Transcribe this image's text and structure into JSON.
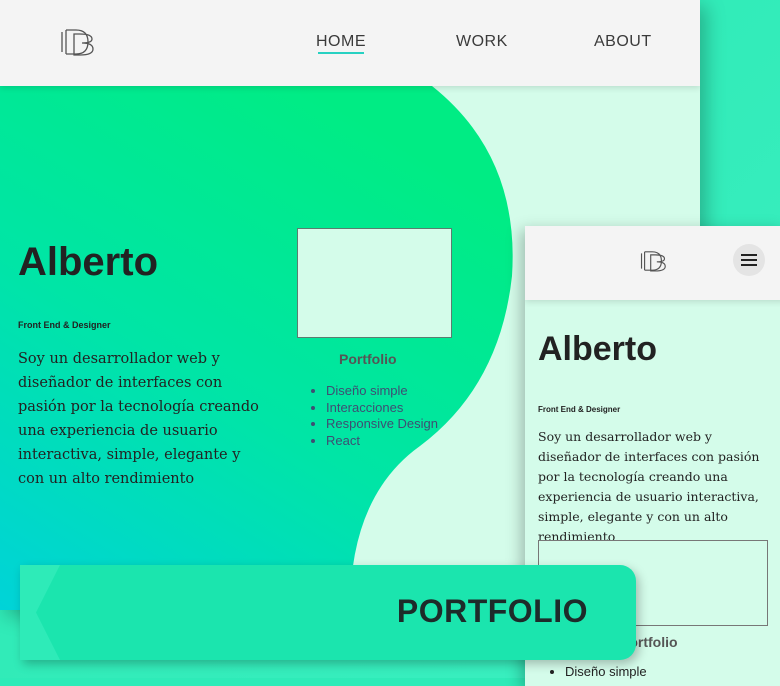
{
  "nav": {
    "home": "HOME",
    "work": "WORK",
    "about": "ABOUT"
  },
  "hero": {
    "name": "Alberto",
    "subtitle": "Front End & Designer",
    "description": "Soy un desarrollador web y diseñador de interfaces con pasión por la tecnología creando una experiencia de usuario interactiva, simple, elegante y con un alto rendimiento"
  },
  "portfolio_card": {
    "title": "Portfolio",
    "items": [
      "Diseño simple",
      "Interacciones",
      "Responsive Design",
      "React"
    ]
  },
  "mobile": {
    "name": "Alberto",
    "subtitle": "Front End & Designer",
    "description": "Soy un desarrollador web y diseñador de interfaces con pasión por la tecnología creando una experiencia de usuario interactiva, simple, elegante y con un alto rendimiento",
    "portfolio_title": "Portfolio",
    "items": [
      "Diseño simple"
    ],
    "menu_icon": "hamburger-icon"
  },
  "banner": {
    "label": "PORTFOLIO"
  },
  "colors": {
    "accent": "#27d1c2",
    "mint_bg": "#d4fcea",
    "gradient_start": "#00e8a0",
    "gradient_end": "#00d7d6",
    "ribbon": "#1be5ae"
  },
  "icons": {
    "logo": "db-monogram-logo"
  }
}
